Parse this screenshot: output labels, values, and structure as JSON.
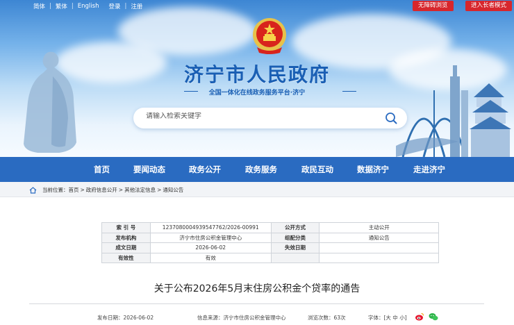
{
  "topbar": {
    "links": [
      "简体",
      "繁体",
      "English",
      "登录",
      "注册"
    ],
    "accessibility_btn": "无障碍浏览",
    "elder_btn": "进入长者模式"
  },
  "header": {
    "title": "济宁市人民政府",
    "subtitle": "全国一体化在线政务服务平台·济宁",
    "search_placeholder": "请输入检索关键字"
  },
  "nav": {
    "items": [
      "首页",
      "要闻动态",
      "政务公开",
      "政务服务",
      "政民互动",
      "数据济宁",
      "走进济宁"
    ]
  },
  "breadcrumb": {
    "prefix": "当前位置：",
    "items": [
      "首页",
      "政府信息公开",
      "其他法定信息",
      "通知公告"
    ],
    "sep": ">"
  },
  "meta_table": {
    "rows": [
      {
        "k1": "索 引 号",
        "v1": "1237080004939547762/2026-00991",
        "k2": "公开方式",
        "v2": "主动公开"
      },
      {
        "k1": "发布机构",
        "v1": "济宁市住房公积金管理中心",
        "k2": "组配分类",
        "v2": "通知公告"
      },
      {
        "k1": "成文日期",
        "v1": "2026-06-02",
        "k2": "失效日期",
        "v2": ""
      },
      {
        "k1": "有效性",
        "v1": "有效",
        "k2": "",
        "v2": ""
      }
    ]
  },
  "document": {
    "title": "关于公布2026年5月末住房公积金个贷率的通告",
    "publish_date": "发布日期：2026-06-02",
    "source": "信息来源：济宁市住房公积金管理中心",
    "views": "浏览次数：63次",
    "font_size": "字体：[大 中 小]"
  },
  "colors": {
    "nav_bg": "#2a6bc1",
    "title_blue": "#1a5fb4",
    "button_red": "#d7262c"
  }
}
